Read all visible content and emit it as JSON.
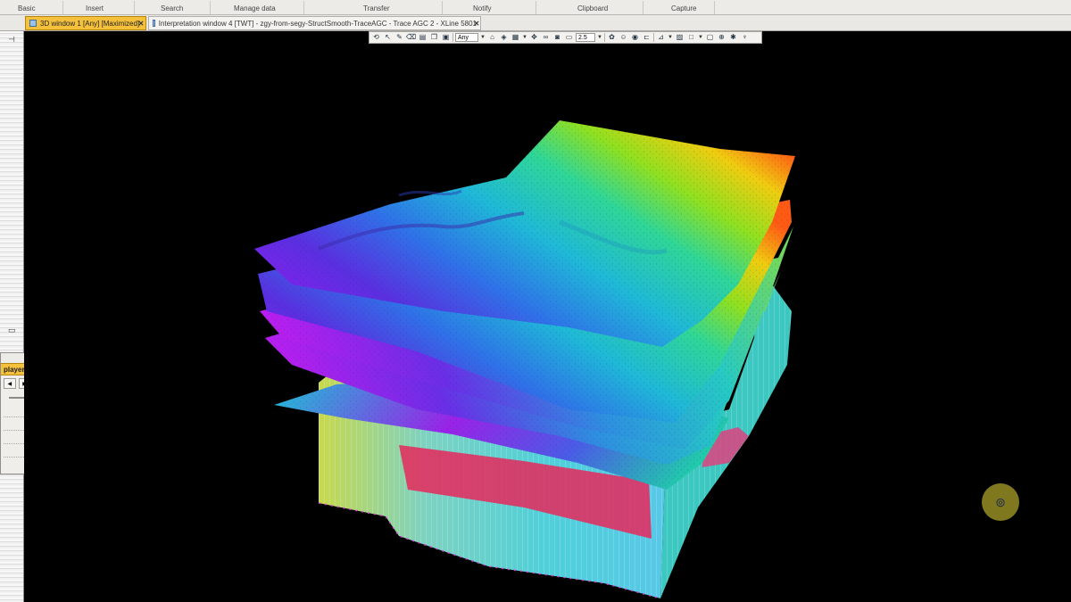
{
  "ribbon": {
    "groups": [
      "Basic",
      "Insert",
      "Search",
      "Manage data",
      "Transfer",
      "Notify",
      "Clipboard",
      "Capture"
    ]
  },
  "tabs": [
    {
      "label": "3D window 1 [Any] [Maximized]",
      "active": true
    },
    {
      "label": "Interpretation window 4 [TWT] - zgy-from-segy-StructSmooth-TraceAGC - Trace AGC 2 - XLine 5801",
      "active": false
    }
  ],
  "toolbar": {
    "domain_select": "Any",
    "zoom_value": "2.5",
    "icons": [
      "rotate-icon",
      "select-icon",
      "pick-icon",
      "erase-icon",
      "layers-icon",
      "copy-icon",
      "paste-icon",
      "home-icon",
      "view-icon",
      "grid-icon",
      "move-icon",
      "binoculars-icon",
      "camera-icon",
      "display-icon",
      "paint-icon",
      "face-icon",
      "eye-icon",
      "ruler-icon",
      "measure-icon",
      "chart-icon",
      "image-icon",
      "box-icon",
      "export-icon",
      "settings-icon",
      "pin-icon"
    ]
  },
  "player": {
    "title": "player",
    "buttons": [
      "prev",
      "play",
      "next"
    ]
  },
  "colors": {
    "tab_active": "#f5c13c",
    "viewport_bg": "#000000",
    "cursor_ring": "#aaa028"
  }
}
